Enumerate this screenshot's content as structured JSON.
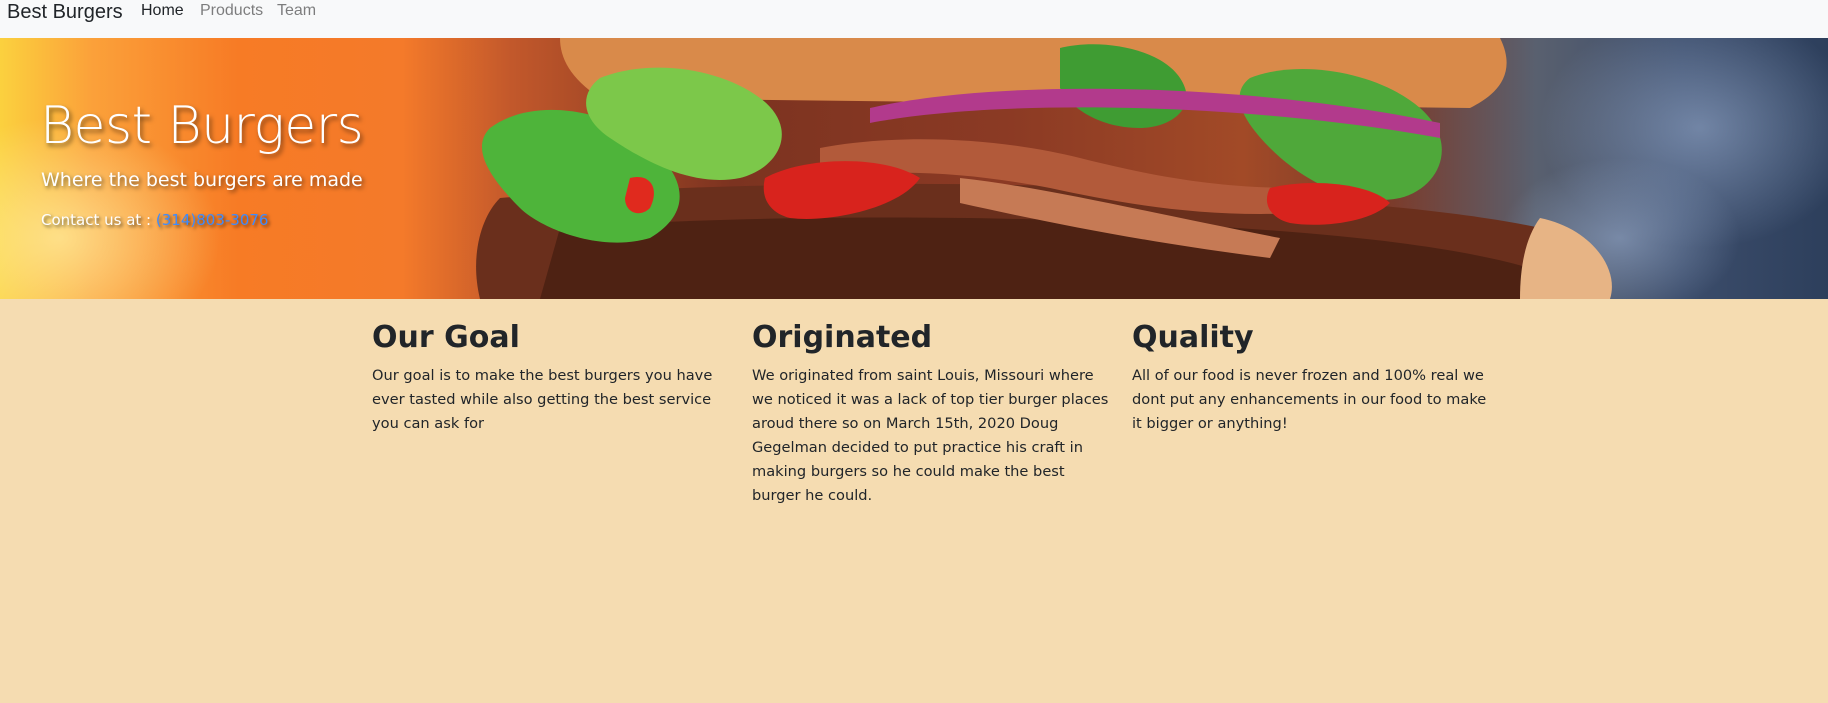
{
  "navbar": {
    "brand": "Best Burgers",
    "links": [
      {
        "label": "Home",
        "active": true
      },
      {
        "label": "Products",
        "active": false
      },
      {
        "label": "Team",
        "active": false
      }
    ]
  },
  "hero": {
    "title": "Best Burgers",
    "subtitle": "Where the best burgers are made",
    "contact_label": "Contact us at :",
    "contact_phone": "(314)803-3076"
  },
  "sections": [
    {
      "heading": "Our Goal",
      "body": "Our goal is to make the best burgers you have ever tasted while also getting the best service you can ask for"
    },
    {
      "heading": "Originated",
      "body": "We originated from saint Louis, Missouri where we noticed it was a lack of top tier burger places aroud there so on March 15th, 2020 Doug Gegelman decided to put practice his craft in making burgers so he could make the best burger he could."
    },
    {
      "heading": "Quality",
      "body": "All of our food is never frozen and 100% real we dont put any enhancements in our food to make it bigger or anything!"
    }
  ],
  "colors": {
    "page_background": "#f5dcb1",
    "navbar_background": "#f8f9fa",
    "link_blue": "#3d8bfd"
  }
}
